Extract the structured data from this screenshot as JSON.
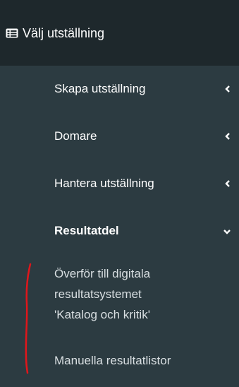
{
  "header": {
    "title": "Välj utställning",
    "icon": "list-alt-icon"
  },
  "menu": {
    "items": [
      {
        "label": "Skapa utställning",
        "icon": "chevron-left-icon"
      },
      {
        "label": "Domare",
        "icon": "chevron-left-icon"
      },
      {
        "label": "Hantera utställning",
        "icon": "chevron-left-icon"
      },
      {
        "label": "Resultatdel",
        "icon": "chevron-down-icon"
      }
    ],
    "subitems": [
      {
        "lines": [
          "Överför till digitala",
          "resultatsystemet",
          "'Katalog och kritik'"
        ]
      },
      {
        "lines": [
          "Manuella resultatlistor"
        ]
      }
    ]
  },
  "colors": {
    "header_bg": "#1e282c",
    "menu_bg": "#2c3b41",
    "text": "#ffffff",
    "annotation": "#e0161b"
  }
}
